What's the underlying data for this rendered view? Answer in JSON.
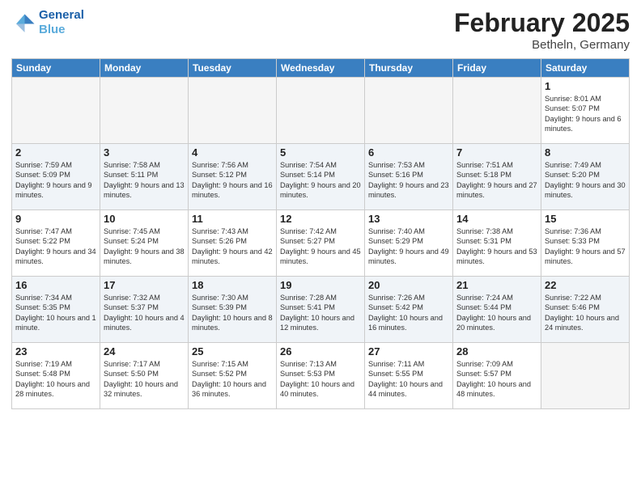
{
  "header": {
    "logo_line1": "General",
    "logo_line2": "Blue",
    "month_title": "February 2025",
    "location": "Betheln, Germany"
  },
  "weekdays": [
    "Sunday",
    "Monday",
    "Tuesday",
    "Wednesday",
    "Thursday",
    "Friday",
    "Saturday"
  ],
  "weeks": [
    [
      {
        "day": "",
        "info": ""
      },
      {
        "day": "",
        "info": ""
      },
      {
        "day": "",
        "info": ""
      },
      {
        "day": "",
        "info": ""
      },
      {
        "day": "",
        "info": ""
      },
      {
        "day": "",
        "info": ""
      },
      {
        "day": "1",
        "info": "Sunrise: 8:01 AM\nSunset: 5:07 PM\nDaylight: 9 hours and 6 minutes."
      }
    ],
    [
      {
        "day": "2",
        "info": "Sunrise: 7:59 AM\nSunset: 5:09 PM\nDaylight: 9 hours and 9 minutes."
      },
      {
        "day": "3",
        "info": "Sunrise: 7:58 AM\nSunset: 5:11 PM\nDaylight: 9 hours and 13 minutes."
      },
      {
        "day": "4",
        "info": "Sunrise: 7:56 AM\nSunset: 5:12 PM\nDaylight: 9 hours and 16 minutes."
      },
      {
        "day": "5",
        "info": "Sunrise: 7:54 AM\nSunset: 5:14 PM\nDaylight: 9 hours and 20 minutes."
      },
      {
        "day": "6",
        "info": "Sunrise: 7:53 AM\nSunset: 5:16 PM\nDaylight: 9 hours and 23 minutes."
      },
      {
        "day": "7",
        "info": "Sunrise: 7:51 AM\nSunset: 5:18 PM\nDaylight: 9 hours and 27 minutes."
      },
      {
        "day": "8",
        "info": "Sunrise: 7:49 AM\nSunset: 5:20 PM\nDaylight: 9 hours and 30 minutes."
      }
    ],
    [
      {
        "day": "9",
        "info": "Sunrise: 7:47 AM\nSunset: 5:22 PM\nDaylight: 9 hours and 34 minutes."
      },
      {
        "day": "10",
        "info": "Sunrise: 7:45 AM\nSunset: 5:24 PM\nDaylight: 9 hours and 38 minutes."
      },
      {
        "day": "11",
        "info": "Sunrise: 7:43 AM\nSunset: 5:26 PM\nDaylight: 9 hours and 42 minutes."
      },
      {
        "day": "12",
        "info": "Sunrise: 7:42 AM\nSunset: 5:27 PM\nDaylight: 9 hours and 45 minutes."
      },
      {
        "day": "13",
        "info": "Sunrise: 7:40 AM\nSunset: 5:29 PM\nDaylight: 9 hours and 49 minutes."
      },
      {
        "day": "14",
        "info": "Sunrise: 7:38 AM\nSunset: 5:31 PM\nDaylight: 9 hours and 53 minutes."
      },
      {
        "day": "15",
        "info": "Sunrise: 7:36 AM\nSunset: 5:33 PM\nDaylight: 9 hours and 57 minutes."
      }
    ],
    [
      {
        "day": "16",
        "info": "Sunrise: 7:34 AM\nSunset: 5:35 PM\nDaylight: 10 hours and 1 minute."
      },
      {
        "day": "17",
        "info": "Sunrise: 7:32 AM\nSunset: 5:37 PM\nDaylight: 10 hours and 4 minutes."
      },
      {
        "day": "18",
        "info": "Sunrise: 7:30 AM\nSunset: 5:39 PM\nDaylight: 10 hours and 8 minutes."
      },
      {
        "day": "19",
        "info": "Sunrise: 7:28 AM\nSunset: 5:41 PM\nDaylight: 10 hours and 12 minutes."
      },
      {
        "day": "20",
        "info": "Sunrise: 7:26 AM\nSunset: 5:42 PM\nDaylight: 10 hours and 16 minutes."
      },
      {
        "day": "21",
        "info": "Sunrise: 7:24 AM\nSunset: 5:44 PM\nDaylight: 10 hours and 20 minutes."
      },
      {
        "day": "22",
        "info": "Sunrise: 7:22 AM\nSunset: 5:46 PM\nDaylight: 10 hours and 24 minutes."
      }
    ],
    [
      {
        "day": "23",
        "info": "Sunrise: 7:19 AM\nSunset: 5:48 PM\nDaylight: 10 hours and 28 minutes."
      },
      {
        "day": "24",
        "info": "Sunrise: 7:17 AM\nSunset: 5:50 PM\nDaylight: 10 hours and 32 minutes."
      },
      {
        "day": "25",
        "info": "Sunrise: 7:15 AM\nSunset: 5:52 PM\nDaylight: 10 hours and 36 minutes."
      },
      {
        "day": "26",
        "info": "Sunrise: 7:13 AM\nSunset: 5:53 PM\nDaylight: 10 hours and 40 minutes."
      },
      {
        "day": "27",
        "info": "Sunrise: 7:11 AM\nSunset: 5:55 PM\nDaylight: 10 hours and 44 minutes."
      },
      {
        "day": "28",
        "info": "Sunrise: 7:09 AM\nSunset: 5:57 PM\nDaylight: 10 hours and 48 minutes."
      },
      {
        "day": "",
        "info": ""
      }
    ]
  ]
}
